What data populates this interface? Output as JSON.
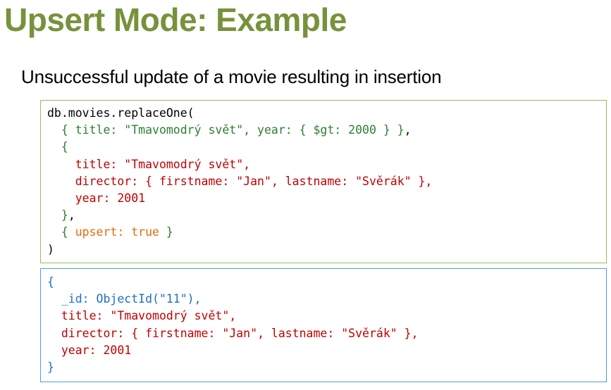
{
  "slide": {
    "title": "Upsert Mode: Example",
    "subtitle": "Unsuccessful update of a movie resulting in insertion"
  },
  "colors": {
    "title": "#76923c",
    "black": "#000000",
    "green": "#2e7d32",
    "red": "#c00000",
    "orange": "#e36c09",
    "blue": "#1f6fbf",
    "box_query_border": "#9bbb59",
    "box_result_border": "#4f9fd8"
  },
  "query_code": {
    "lines": [
      [
        {
          "text": "db.movies.replaceOne(",
          "color": "black"
        }
      ],
      [
        {
          "text": "  { title: \"Tmavomodrý svět\", year: { $gt: 2000 } }",
          "color": "green"
        },
        {
          "text": ",",
          "color": "black"
        }
      ],
      [
        {
          "text": "  {",
          "color": "green"
        }
      ],
      [
        {
          "text": "    title: \"Tmavomodrý svět\",",
          "color": "red"
        }
      ],
      [
        {
          "text": "    director: { firstname: \"Jan\", lastname: \"Svěrák\" },",
          "color": "red"
        }
      ],
      [
        {
          "text": "    year: 2001",
          "color": "red"
        }
      ],
      [
        {
          "text": "  }",
          "color": "green"
        },
        {
          "text": ",",
          "color": "black"
        }
      ],
      [
        {
          "text": "  { ",
          "color": "green"
        },
        {
          "text": "upsert: true",
          "color": "orange"
        },
        {
          "text": " }",
          "color": "green"
        }
      ],
      [
        {
          "text": ")",
          "color": "black"
        }
      ]
    ]
  },
  "result_code": {
    "lines": [
      [
        {
          "text": "{",
          "color": "blue"
        }
      ],
      [
        {
          "text": "  _id: ObjectId(\"11\"),",
          "color": "blue"
        }
      ],
      [
        {
          "text": "  title: \"Tmavomodrý svět\",",
          "color": "red"
        }
      ],
      [
        {
          "text": "  director: { firstname: \"Jan\", lastname: \"Svěrák\" },",
          "color": "red"
        }
      ],
      [
        {
          "text": "  year: 2001",
          "color": "red"
        }
      ],
      [
        {
          "text": "}",
          "color": "blue"
        }
      ]
    ]
  }
}
